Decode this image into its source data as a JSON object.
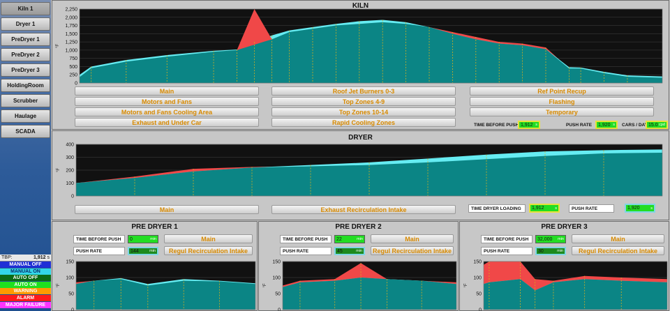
{
  "nav": [
    {
      "label": "Kiln 1",
      "active": true
    },
    {
      "label": "Dryer 1",
      "active": false
    },
    {
      "label": "PreDryer 1",
      "active": false
    },
    {
      "label": "PreDryer 2",
      "active": false
    },
    {
      "label": "PreDryer 3",
      "active": false
    },
    {
      "label": "HoldingRoom",
      "active": false
    },
    {
      "label": "Scrubber",
      "active": false
    },
    {
      "label": "Haulage",
      "active": false
    },
    {
      "label": "SCADA",
      "active": false
    }
  ],
  "tbp": {
    "label": "TBP:",
    "value": "1,912",
    "unit": "s"
  },
  "legend": [
    {
      "label": "MANUAL OFF",
      "bg": "#1f2fd6",
      "fg": "#ffffff"
    },
    {
      "label": "MANUAL ON",
      "bg": "#33d6e8",
      "fg": "#0a2a6a"
    },
    {
      "label": "AUTO OFF",
      "bg": "#0b6b16",
      "fg": "#ffffff"
    },
    {
      "label": "AUTO ON",
      "bg": "#20e020",
      "fg": "#ffffff"
    },
    {
      "label": "WARNING",
      "bg": "#ff9a00",
      "fg": "#ffffff"
    },
    {
      "label": "ALARM",
      "bg": "#ff1a1a",
      "fg": "#ffffff"
    },
    {
      "label": "MAJOR FAILURE",
      "bg": "#ff33ff",
      "fg": "#ffffff"
    }
  ],
  "colors": {
    "actual": "#0b8585",
    "setpoint": "#66ecf2",
    "overshoot": "#f04848",
    "zone_line": "#d4b020",
    "plot_bg": "#111111"
  },
  "kiln": {
    "title": "KILN",
    "buttons": [
      [
        "Main",
        "Motors and Fans",
        "Motors and Fans Cooling Area",
        "Exhaust and Under Car"
      ],
      [
        "Roof Jet Burners 0-3",
        "Top Zones 4-9",
        "Top Zones 10-14",
        "Rapid Cooling Zones"
      ],
      [
        "Ref Point Recup",
        "Flashing",
        "Temporary"
      ]
    ],
    "status": [
      {
        "label": "TIME BEFORE PUSH",
        "value": "1,912",
        "unit": "s"
      },
      {
        "label": "PUSH RATE",
        "value": "1,920",
        "unit": "s"
      },
      {
        "label": "CARS / DAY",
        "value": "15.0",
        "unit": "cpd"
      }
    ],
    "ylabel": "°F"
  },
  "dryer": {
    "title": "DRYER",
    "buttons": [
      "Main",
      "Exhaust Recirculation Intake"
    ],
    "status": [
      {
        "label": "TIME DRYER LOADING",
        "value": "1,912",
        "unit": "s"
      },
      {
        "label": "PUSH RATE",
        "value": "1,920",
        "unit": "s"
      }
    ],
    "ylabel": "°F"
  },
  "predryers": [
    {
      "title": "PRE DRYER 1",
      "tbp_label": "TIME BEFORE PUSH",
      "tbp_value": "0",
      "tbp_unit": "min",
      "rate_label": "PUSH RATE",
      "rate_value": "144",
      "rate_unit": "min",
      "buttons": [
        "Main",
        "Regul Recirculation Intake"
      ],
      "ylabel": "°F"
    },
    {
      "title": "PRE DRYER 2",
      "tbp_label": "TIME BEFORE PUSH",
      "tbp_value": "22",
      "tbp_unit": "min",
      "rate_label": "PUSH RATE",
      "rate_value": "45",
      "rate_unit": "min",
      "buttons": [
        "Main",
        "Regul Recirculation Intake"
      ],
      "ylabel": "°F"
    },
    {
      "title": "PRE DRYER 3",
      "tbp_label": "TIME BEFORE PUSH",
      "tbp_value": "32,000",
      "tbp_unit": "min",
      "rate_label": "PUSH RATE",
      "rate_value": "30",
      "rate_unit": "min",
      "buttons": [
        "Main",
        "Regul Recirculation Intake"
      ],
      "ylabel": "°F"
    }
  ],
  "chart_data": [
    {
      "name": "kiln",
      "type": "area",
      "ylim": [
        0,
        2250
      ],
      "yticks": [
        0,
        250,
        500,
        750,
        1000,
        1250,
        1500,
        1750,
        2000,
        2250
      ],
      "x": [
        0,
        0.02,
        0.08,
        0.15,
        0.23,
        0.27,
        0.3,
        0.33,
        0.36,
        0.4,
        0.44,
        0.48,
        0.52,
        0.56,
        0.6,
        0.64,
        0.68,
        0.72,
        0.76,
        0.8,
        0.84,
        0.86,
        0.9,
        0.94,
        1
      ],
      "series": [
        {
          "name": "actual",
          "values": [
            180,
            450,
            650,
            800,
            950,
            1000,
            1200,
            1330,
            1550,
            1650,
            1750,
            1800,
            1850,
            1800,
            1700,
            1550,
            1400,
            1250,
            1200,
            1080,
            440,
            440,
            300,
            190,
            160
          ]
        },
        {
          "name": "setpoint",
          "values": [
            250,
            500,
            700,
            850,
            980,
            1020,
            1250,
            1450,
            1600,
            1700,
            1800,
            1880,
            1920,
            1850,
            1700,
            1500,
            1330,
            1200,
            1150,
            1030,
            480,
            470,
            340,
            230,
            200
          ]
        },
        {
          "name": "peak",
          "values": [
            null,
            null,
            null,
            null,
            null,
            1000,
            2250,
            1330,
            null,
            null,
            null,
            null,
            null,
            null,
            null,
            null,
            null,
            null,
            null,
            null,
            null,
            null,
            null,
            null,
            null
          ]
        }
      ]
    },
    {
      "name": "dryer",
      "type": "area",
      "ylim": [
        0,
        400
      ],
      "yticks": [
        0,
        100,
        200,
        300,
        400
      ],
      "x": [
        0,
        0.1,
        0.2,
        0.3,
        0.4,
        0.5,
        0.6,
        0.7,
        0.8,
        0.9,
        1
      ],
      "series": [
        {
          "name": "actual",
          "values": [
            100,
            150,
            210,
            225,
            230,
            240,
            260,
            285,
            310,
            330,
            335
          ]
        },
        {
          "name": "setpoint",
          "values": [
            100,
            140,
            190,
            220,
            240,
            260,
            290,
            320,
            345,
            355,
            360
          ]
        }
      ]
    },
    {
      "name": "predryer1",
      "type": "area",
      "ylim": [
        0,
        150
      ],
      "yticks": [
        0,
        50,
        100,
        150
      ],
      "x": [
        0,
        0.1,
        0.25,
        0.4,
        0.6,
        0.8,
        1
      ],
      "series": [
        {
          "name": "actual",
          "values": [
            85,
            90,
            95,
            75,
            90,
            88,
            80
          ]
        },
        {
          "name": "setpoint",
          "values": [
            80,
            90,
            98,
            80,
            95,
            90,
            82
          ]
        }
      ]
    },
    {
      "name": "predryer2",
      "type": "area",
      "ylim": [
        0,
        150
      ],
      "yticks": [
        0,
        50,
        100,
        150
      ],
      "x": [
        0,
        0.1,
        0.3,
        0.45,
        0.6,
        0.8,
        1
      ],
      "series": [
        {
          "name": "actual",
          "values": [
            75,
            90,
            95,
            145,
            95,
            90,
            85
          ]
        },
        {
          "name": "setpoint",
          "values": [
            70,
            85,
            90,
            100,
            95,
            90,
            80
          ]
        }
      ]
    },
    {
      "name": "predryer3",
      "type": "area",
      "ylim": [
        0,
        150
      ],
      "yticks": [
        0,
        50,
        100,
        150
      ],
      "x": [
        0,
        0.03,
        0.2,
        0.28,
        0.38,
        0.55,
        0.75,
        1
      ],
      "series": [
        {
          "name": "actual",
          "values": [
            140,
            150,
            150,
            95,
            90,
            105,
            100,
            95
          ]
        },
        {
          "name": "setpoint",
          "values": [
            80,
            85,
            95,
            60,
            85,
            95,
            90,
            85
          ]
        }
      ]
    }
  ]
}
